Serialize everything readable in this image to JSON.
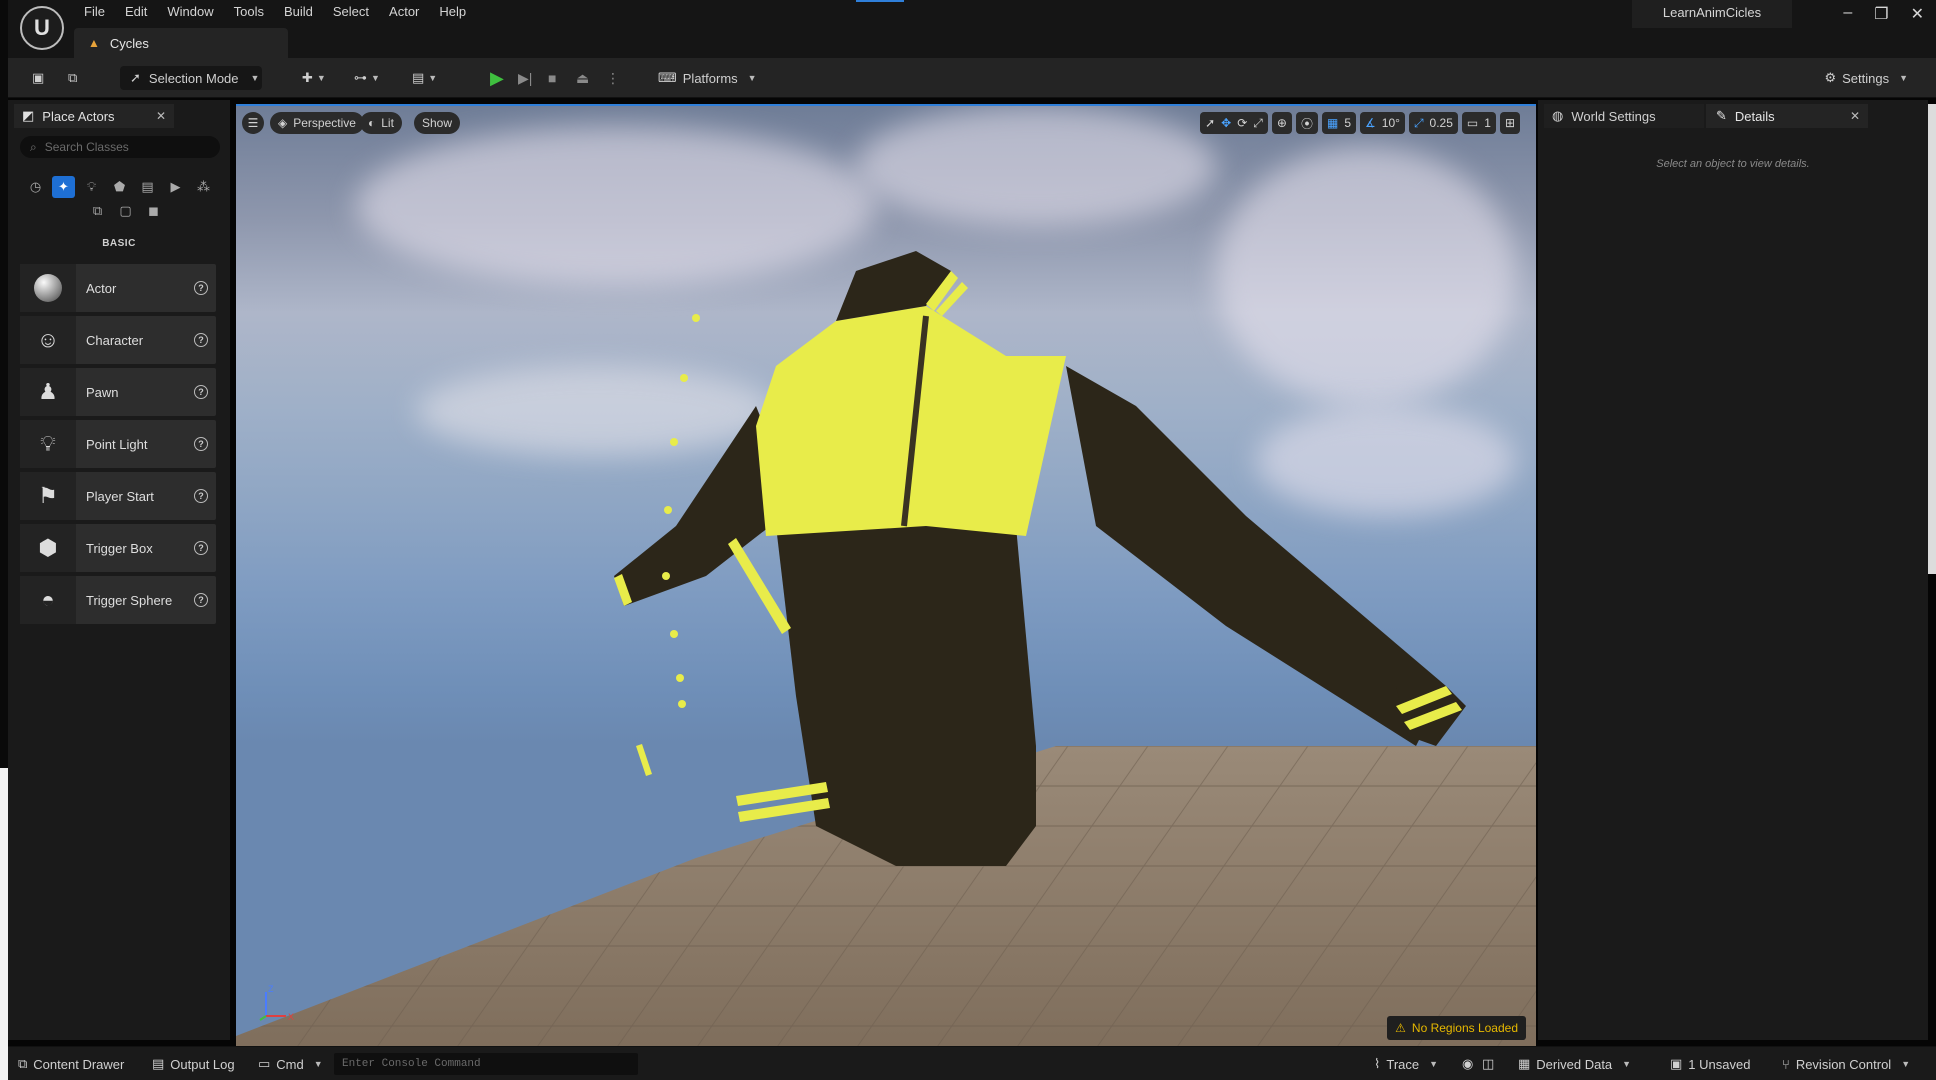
{
  "menu": [
    "File",
    "Edit",
    "Window",
    "Tools",
    "Build",
    "Select",
    "Actor",
    "Help"
  ],
  "document_tab": "Cycles",
  "project_name": "LearnAnimCicles",
  "toolbar": {
    "selection_mode": "Selection Mode",
    "platforms": "Platforms",
    "settings": "Settings"
  },
  "place_actors": {
    "tab_title": "Place Actors",
    "search_placeholder": "Search Classes",
    "section": "BASIC",
    "items": [
      {
        "label": "Actor",
        "icon": "sphere-icon"
      },
      {
        "label": "Character",
        "icon": "character-icon"
      },
      {
        "label": "Pawn",
        "icon": "pawn-icon"
      },
      {
        "label": "Point Light",
        "icon": "light-bulb-icon"
      },
      {
        "label": "Player Start",
        "icon": "player-start-icon"
      },
      {
        "label": "Trigger Box",
        "icon": "trigger-box-icon"
      },
      {
        "label": "Trigger Sphere",
        "icon": "trigger-sphere-icon"
      }
    ]
  },
  "viewport": {
    "perspective": "Perspective",
    "lit": "Lit",
    "show": "Show",
    "grid_snap": "5",
    "rotation_snap": "10°",
    "scale_snap": "0.25",
    "camera_speed": "1",
    "no_regions": "No Regions Loaded",
    "axis_z": "Z",
    "axis_x": "X"
  },
  "details": {
    "world_settings_tab": "World Settings",
    "details_tab": "Details",
    "hint": "Select an object to view details."
  },
  "statusbar": {
    "content_drawer": "Content Drawer",
    "output_log": "Output Log",
    "cmd": "Cmd",
    "console_placeholder": "Enter Console Command",
    "trace": "Trace",
    "derived_data": "Derived Data",
    "unsaved": "1 Unsaved",
    "revision_control": "Revision Control"
  },
  "colors": {
    "accent": "#2f7fd9",
    "jacket_yellow": "#e8ec4a",
    "jacket_dark": "#2c2619",
    "warning": "#e6b800"
  }
}
